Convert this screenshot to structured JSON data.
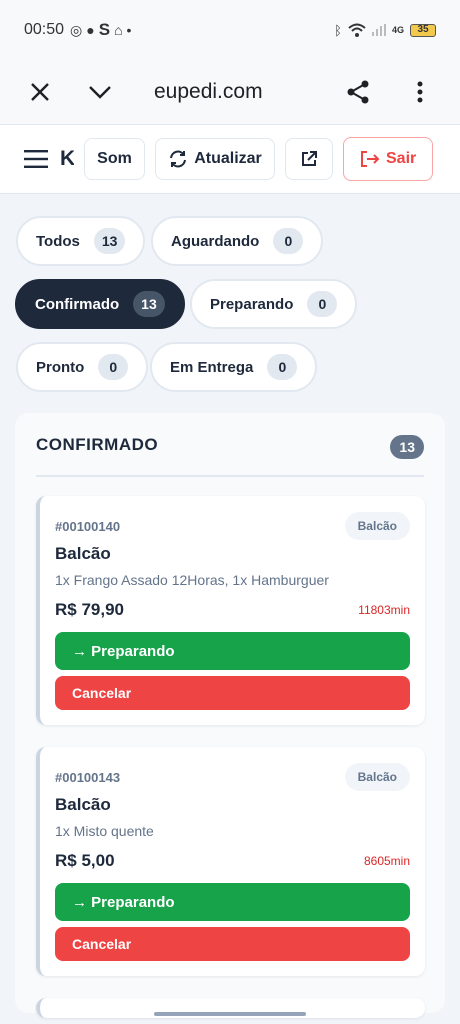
{
  "status_bar": {
    "time": "00:50",
    "battery": "35",
    "network": "4G"
  },
  "browser": {
    "url": "eupedi.com"
  },
  "toolbar": {
    "brand_letter": "K",
    "sound_label": "Som",
    "refresh_label": "Atualizar",
    "logout_label": "Sair"
  },
  "filters": [
    {
      "label": "Todos",
      "count": "13"
    },
    {
      "label": "Aguardando",
      "count": "0"
    },
    {
      "label": "Confirmado",
      "count": "13",
      "active": true
    },
    {
      "label": "Preparando",
      "count": "0"
    },
    {
      "label": "Pronto",
      "count": "0"
    },
    {
      "label": "Em Entrega",
      "count": "0"
    }
  ],
  "column": {
    "title": "CONFIRMADO",
    "count": "13"
  },
  "orders": [
    {
      "number": "#00100140",
      "badge": "Balcão",
      "title": "Balcão",
      "items": "1x Frango Assado 12Horas, 1x Hamburguer",
      "price": "R$ 79,90",
      "elapsed": "11803min",
      "advance_label": "→ Preparando",
      "cancel_label": "Cancelar"
    },
    {
      "number": "#00100143",
      "badge": "Balcão",
      "title": "Balcão",
      "items": "1x Misto quente",
      "price": "R$ 5,00",
      "elapsed": "8605min",
      "advance_label": "→ Preparando",
      "cancel_label": "Cancelar"
    }
  ],
  "colors": {
    "accent_dark": "#1e293b",
    "green": "#16a34a",
    "red": "#ef4444"
  }
}
